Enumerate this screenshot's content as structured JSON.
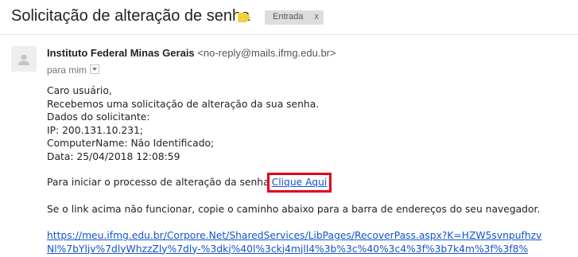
{
  "header": {
    "subject": "Solicitação de alteração de senha",
    "label": "Entrada",
    "label_close": "x"
  },
  "sender": {
    "name": "Instituto Federal Minas Gerais",
    "email": "<no-reply@mails.ifmg.edu.br>",
    "to": "para mim"
  },
  "body": {
    "greeting": "Caro usuário,",
    "line1": "Recebemos uma solicitação de alteração da sua senha.",
    "line2": "Dados do solicitante:",
    "line3": "IP: 200.131.10.231;",
    "line4": "ComputerName: Não Identificado;",
    "line5": "Data: 25/04/2018 12:08:59",
    "line6_prefix": "Para iniciar o processo de alteração da senha",
    "line6_link": "Clique Aqui",
    "line7": "Se o link acima não funcionar, copie o caminho abaixo para a barra de endereços do seu navegador.",
    "url_line1": "https://meu.ifmg.edu.br/Corpore.Net/SharedServices/LibPages/RecoverPass.aspx?K=HZW5svnpufhzv",
    "url_line2": "Nl%7bYljv%7dlyWhzzZly%7dly-%3dkj%40l%3ckj4mjll4%3b%3c%40%3c4%3f%3b7k4m%3f%3f8%"
  },
  "colors": {
    "link": "#1155cc",
    "highlight_box": "#e2001a",
    "importance": "#f4d03f",
    "label_bg": "#dddddd"
  },
  "icons": {
    "importance": "importance-marker-icon",
    "avatar": "person-icon",
    "dropdown": "chevron-down-icon"
  }
}
